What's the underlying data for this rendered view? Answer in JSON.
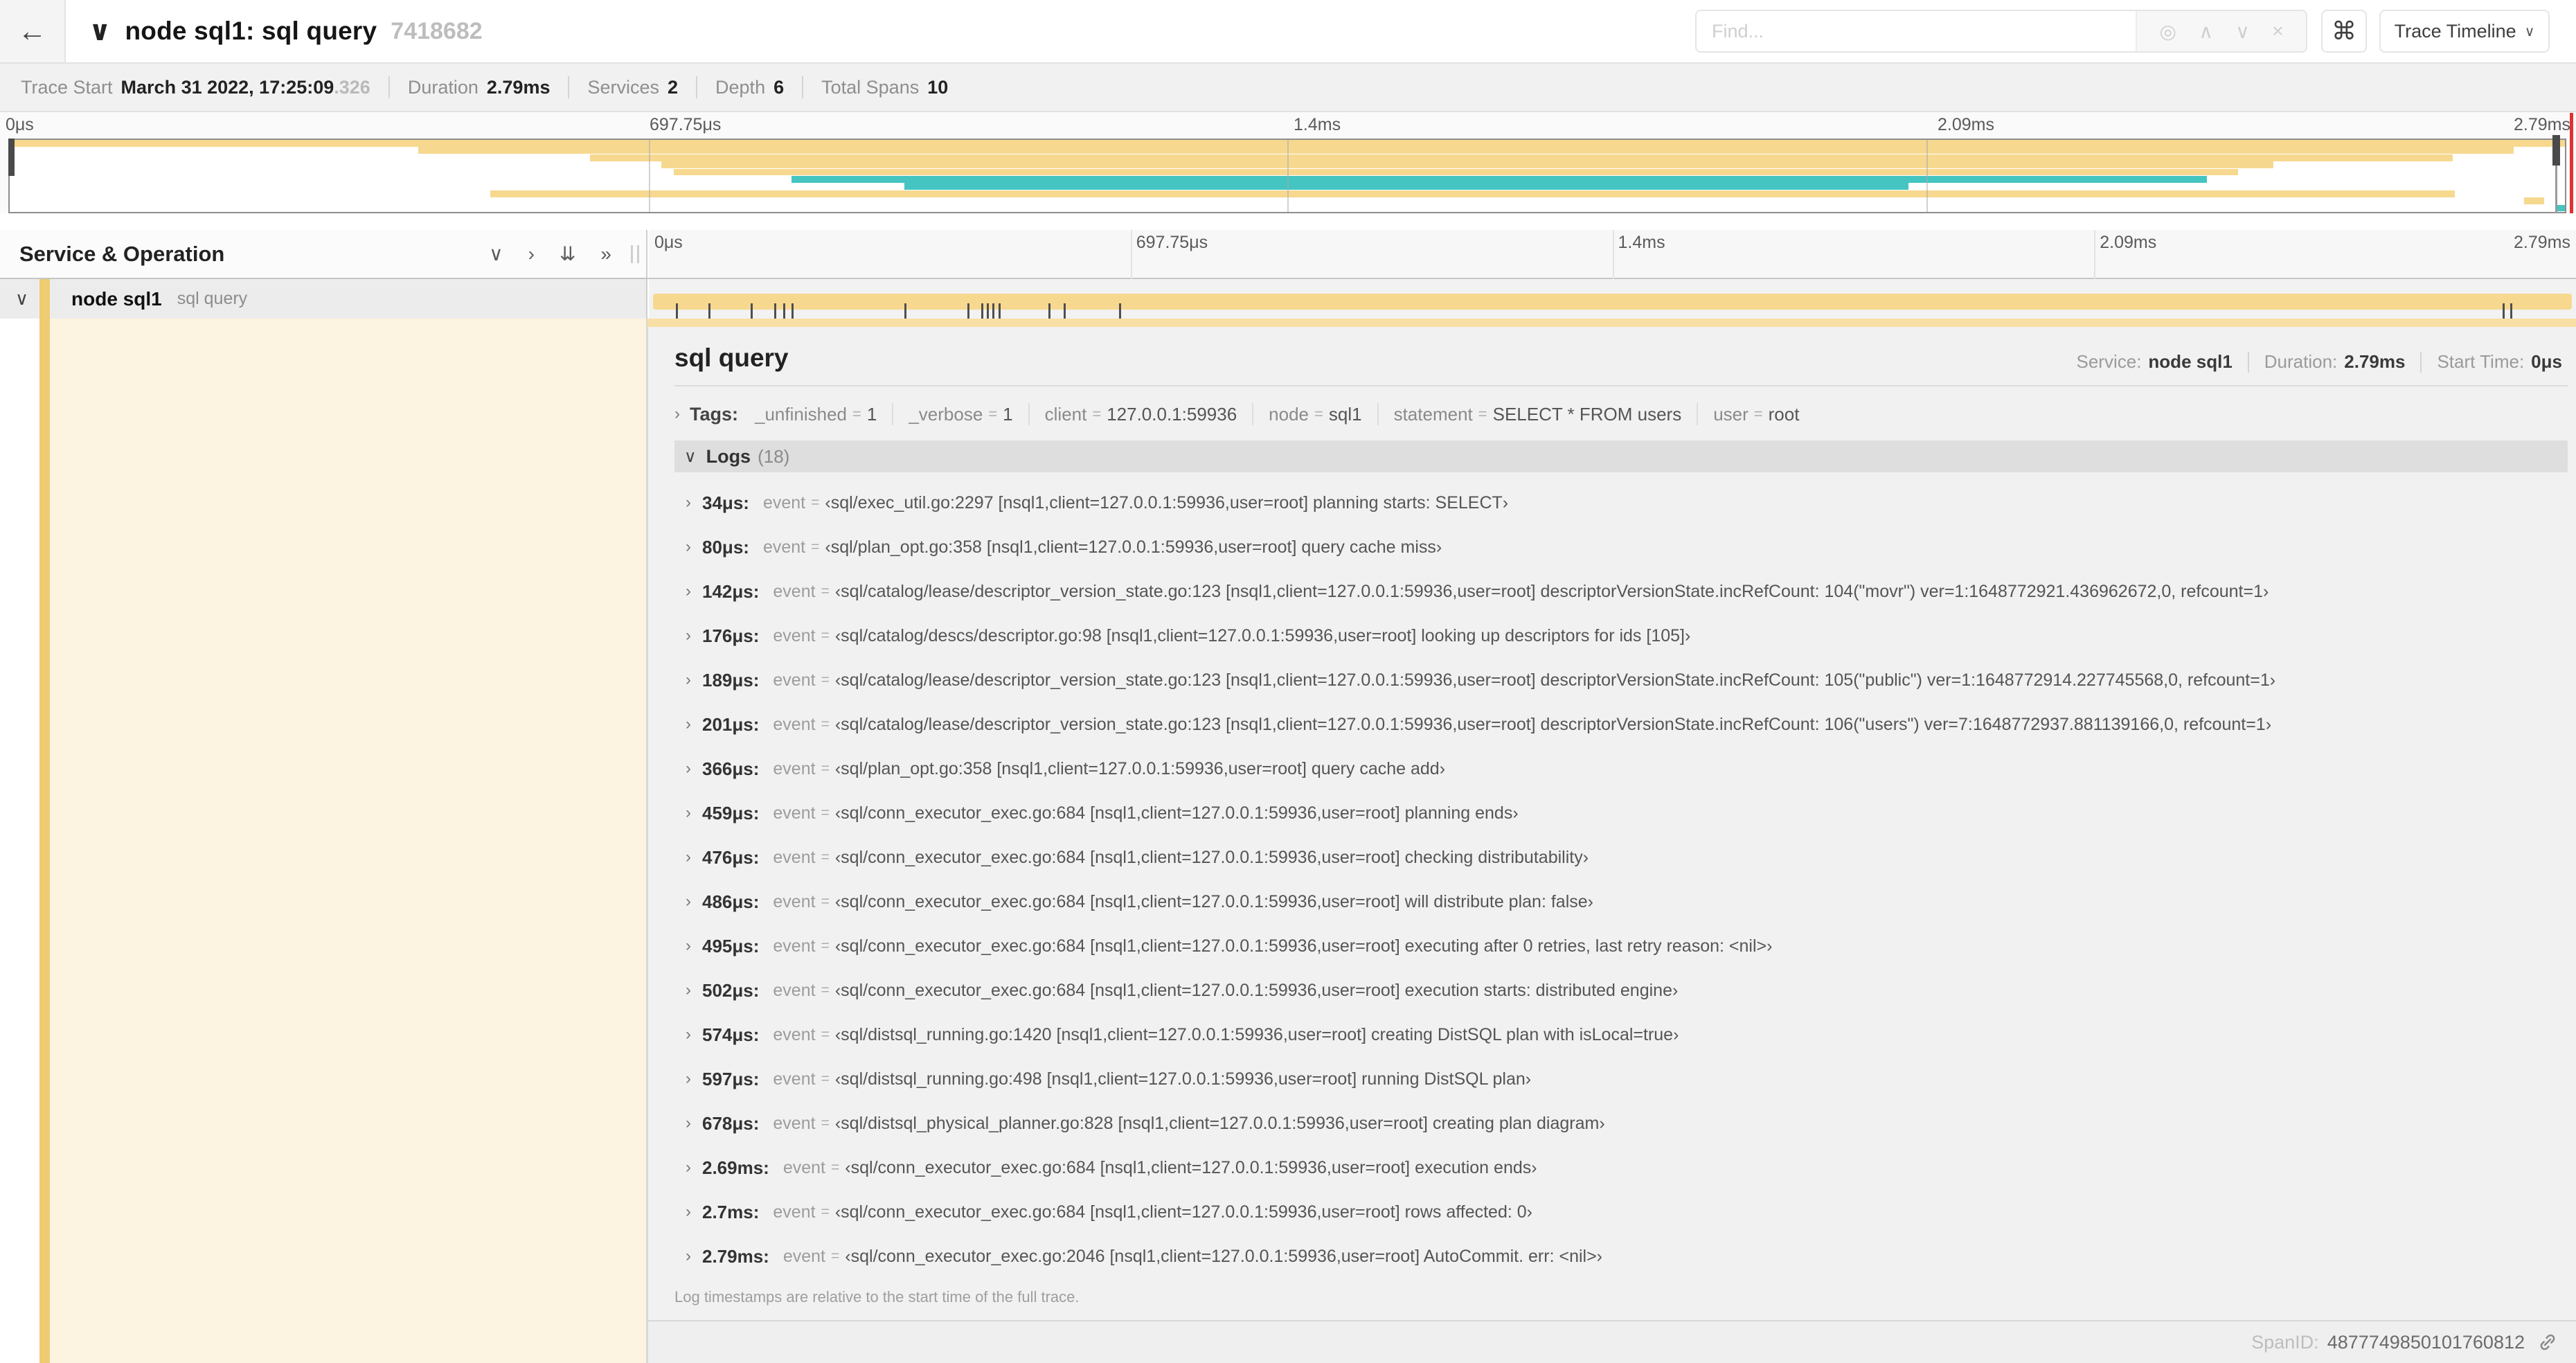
{
  "header": {
    "back_icon": "←",
    "collapse_icon": "∨",
    "title": "node sql1: sql query",
    "trace_id": "7418682",
    "find_placeholder": "Find...",
    "find_icons": [
      "◎",
      "∧",
      "∨",
      "×"
    ],
    "command_icon": "⌘",
    "view_selector_label": "Trace Timeline",
    "view_selector_caret": "∨"
  },
  "summary": {
    "trace_start_label": "Trace Start",
    "trace_start_value": "March 31 2022, 17:25:09",
    "trace_start_ms": ".326",
    "duration_label": "Duration",
    "duration_value": "2.79ms",
    "services_label": "Services",
    "services_value": "2",
    "depth_label": "Depth",
    "depth_value": "6",
    "spans_label": "Total Spans",
    "spans_value": "10"
  },
  "timeline": {
    "left_header": "Service & Operation",
    "collapse_icons": [
      "∨",
      "›",
      "⇊",
      "»"
    ],
    "ticks": [
      "0μs",
      "697.75μs",
      "1.4ms",
      "2.09ms",
      "2.79ms"
    ],
    "tick_positions_pct": [
      0,
      25,
      50,
      75,
      100
    ],
    "colors": {
      "service1": "#F6D88F",
      "service2": "#44C5C2"
    },
    "minimap_spans": [
      {
        "row": 0,
        "start": 0,
        "end": 100,
        "service": 1
      },
      {
        "row": 1,
        "start": 16,
        "end": 98,
        "service": 1
      },
      {
        "row": 2,
        "start": 22.7,
        "end": 95.6,
        "service": 1
      },
      {
        "row": 3,
        "start": 25.5,
        "end": 88.6,
        "service": 1
      },
      {
        "row": 4,
        "start": 26,
        "end": 87.2,
        "service": 1
      },
      {
        "row": 5,
        "start": 30.6,
        "end": 86,
        "service": 2
      },
      {
        "row": 6,
        "start": 35,
        "end": 74.3,
        "service": 2
      },
      {
        "row": 7,
        "start": 18.8,
        "end": 95.7,
        "service": 1
      },
      {
        "row": 8,
        "start": 98.4,
        "end": 99.2,
        "service": 1
      },
      {
        "row": 9,
        "start": 99.7,
        "end": 100,
        "service": 2
      }
    ]
  },
  "span_row": {
    "chevron": "∨",
    "service": "node sql1",
    "operation": "sql query",
    "marker_positions_pct": [
      1.2,
      2.9,
      5.1,
      6.3,
      6.8,
      7.2,
      13.1,
      16.4,
      17.1,
      17.4,
      17.7,
      18.0,
      20.6,
      21.4,
      24.3,
      96.4,
      96.8
    ]
  },
  "detail": {
    "title": "sql query",
    "service_label": "Service:",
    "service": "node sql1",
    "duration_label": "Duration:",
    "duration": "2.79ms",
    "start_label": "Start Time:",
    "start": "0μs",
    "tags_chevron": "›",
    "tags_label": "Tags:",
    "tags": [
      {
        "key": "_unfinished",
        "value": "1"
      },
      {
        "key": "_verbose",
        "value": "1"
      },
      {
        "key": "client",
        "value": "127.0.0.1:59936"
      },
      {
        "key": "node",
        "value": "sql1"
      },
      {
        "key": "statement",
        "value": "SELECT * FROM users"
      },
      {
        "key": "user",
        "value": "root"
      }
    ],
    "logs_chevron": "∨",
    "logs_label": "Logs",
    "logs_count": "(18)",
    "log_row_chevron": "›",
    "logs": [
      {
        "t": "34μs:",
        "key": "event",
        "value": "‹sql/exec_util.go:2297 [nsql1,client=127.0.0.1:59936,user=root] planning starts: SELECT›"
      },
      {
        "t": "80μs:",
        "key": "event",
        "value": "‹sql/plan_opt.go:358 [nsql1,client=127.0.0.1:59936,user=root] query cache miss›"
      },
      {
        "t": "142μs:",
        "key": "event",
        "value": "‹sql/catalog/lease/descriptor_version_state.go:123 [nsql1,client=127.0.0.1:59936,user=root] descriptorVersionState.incRefCount: 104(\"movr\") ver=1:1648772921.436962672,0, refcount=1›"
      },
      {
        "t": "176μs:",
        "key": "event",
        "value": "‹sql/catalog/descs/descriptor.go:98 [nsql1,client=127.0.0.1:59936,user=root] looking up descriptors for ids [105]›"
      },
      {
        "t": "189μs:",
        "key": "event",
        "value": "‹sql/catalog/lease/descriptor_version_state.go:123 [nsql1,client=127.0.0.1:59936,user=root] descriptorVersionState.incRefCount: 105(\"public\") ver=1:1648772914.227745568,0, refcount=1›"
      },
      {
        "t": "201μs:",
        "key": "event",
        "value": "‹sql/catalog/lease/descriptor_version_state.go:123 [nsql1,client=127.0.0.1:59936,user=root] descriptorVersionState.incRefCount: 106(\"users\") ver=7:1648772937.881139166,0, refcount=1›"
      },
      {
        "t": "366μs:",
        "key": "event",
        "value": "‹sql/plan_opt.go:358 [nsql1,client=127.0.0.1:59936,user=root] query cache add›"
      },
      {
        "t": "459μs:",
        "key": "event",
        "value": "‹sql/conn_executor_exec.go:684 [nsql1,client=127.0.0.1:59936,user=root] planning ends›"
      },
      {
        "t": "476μs:",
        "key": "event",
        "value": "‹sql/conn_executor_exec.go:684 [nsql1,client=127.0.0.1:59936,user=root] checking distributability›"
      },
      {
        "t": "486μs:",
        "key": "event",
        "value": "‹sql/conn_executor_exec.go:684 [nsql1,client=127.0.0.1:59936,user=root] will distribute plan: false›"
      },
      {
        "t": "495μs:",
        "key": "event",
        "value": "‹sql/conn_executor_exec.go:684 [nsql1,client=127.0.0.1:59936,user=root] executing after 0 retries, last retry reason: <nil>›"
      },
      {
        "t": "502μs:",
        "key": "event",
        "value": "‹sql/conn_executor_exec.go:684 [nsql1,client=127.0.0.1:59936,user=root] execution starts: distributed engine›"
      },
      {
        "t": "574μs:",
        "key": "event",
        "value": "‹sql/distsql_running.go:1420 [nsql1,client=127.0.0.1:59936,user=root] creating DistSQL plan with isLocal=true›"
      },
      {
        "t": "597μs:",
        "key": "event",
        "value": "‹sql/distsql_running.go:498 [nsql1,client=127.0.0.1:59936,user=root] running DistSQL plan›"
      },
      {
        "t": "678μs:",
        "key": "event",
        "value": "‹sql/distsql_physical_planner.go:828 [nsql1,client=127.0.0.1:59936,user=root] creating plan diagram›"
      },
      {
        "t": "2.69ms:",
        "key": "event",
        "value": "‹sql/conn_executor_exec.go:684 [nsql1,client=127.0.0.1:59936,user=root] execution ends›"
      },
      {
        "t": "2.7ms:",
        "key": "event",
        "value": "‹sql/conn_executor_exec.go:684 [nsql1,client=127.0.0.1:59936,user=root] rows affected: 0›"
      },
      {
        "t": "2.79ms:",
        "key": "event",
        "value": "‹sql/conn_executor_exec.go:2046 [nsql1,client=127.0.0.1:59936,user=root] AutoCommit. err: <nil>›"
      }
    ],
    "logs_note": "Log timestamps are relative to the start time of the full trace.",
    "span_id_label": "SpanID:",
    "span_id": "4877749850101760812"
  }
}
